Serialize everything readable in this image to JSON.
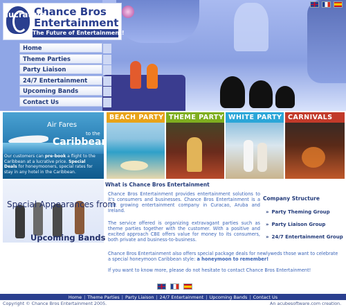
{
  "header": {
    "logo_line1": "Chance Bros",
    "logo_line2": "Entertainment",
    "tagline": "The Future of Entertainment!"
  },
  "nav": {
    "items": [
      {
        "label": "Home"
      },
      {
        "label": "Theme Parties"
      },
      {
        "label": "Party Liaison"
      },
      {
        "label": "24/7 Entertainment"
      },
      {
        "label": "Upcoming Bands"
      },
      {
        "label": "Contact Us"
      }
    ]
  },
  "promo": {
    "airfares": {
      "line1": "lucrative",
      "line2": "Air Fares",
      "line2b": "to the",
      "line3": "Caribbean",
      "body_1": "Our customers can",
      "body_bold1": "pre-book",
      "body_2": "a flight to the Caribbean at a lucrative price.",
      "body_bold2": "Special Deals",
      "body_3": "for honeymooners, special rates for stay in any hotel in the Caribbean."
    },
    "cards": [
      {
        "label": "BEACH PARTY",
        "color": "#e8a319"
      },
      {
        "label": "THEME PARTY",
        "color": "#7fae1f"
      },
      {
        "label": "WHITE PARTY",
        "color": "#2ba6d8"
      },
      {
        "label": "CARNIVALS",
        "color": "#c23a2a"
      }
    ]
  },
  "special": {
    "line1": "Special Appearances from",
    "line2": "Upcoming Bands"
  },
  "main": {
    "title": "What is Chance Bros Entertainment",
    "para1": "Chance Bros Entertainment provides entertainment solutions to it's consumers and businesses. Chance Bros Entertainment is a fast growing entertainment company in Curacao, Aruba and Ireland.",
    "para2": "The service offered is organizing extravagant parties such as theme parties together with the customer. With a positive and excited approach CBE offers value for money to its consumers, both private and business-to-business.",
    "para3_a": "Chance Bros Entertainment also offers special package deals for newlyweds those want to celebrate a special honeymoon Caribbean style:",
    "para3_b": "a honeymoon to remember!",
    "para4": "If you want to know more, please do not hesitate to contact Chance Bros Entertainment!"
  },
  "company": {
    "heading": "Company Structure",
    "links": [
      {
        "label": "Party Theming Group"
      },
      {
        "label": "Party Liaison Group"
      },
      {
        "label": "24/7 Entertainment Group"
      }
    ]
  },
  "footer": {
    "links": [
      {
        "label": "Home"
      },
      {
        "label": "Theme Parties"
      },
      {
        "label": "Party Liaison"
      },
      {
        "label": "24/7 Entertainment"
      },
      {
        "label": "Upcoming Bands"
      },
      {
        "label": "Contact Us"
      }
    ],
    "copyright": "Copyright © Chance Bros Entertainment 2005.",
    "credit": "An acubesoftware.com creation."
  },
  "icons": {
    "flag_uk": "flag-uk-icon",
    "flag_fr": "flag-fr-icon",
    "flag_es": "flag-es-icon"
  },
  "colors": {
    "brand": "#2a3f8f",
    "header_bg": "#8fa6e6",
    "link_text": "#3a64b8"
  }
}
